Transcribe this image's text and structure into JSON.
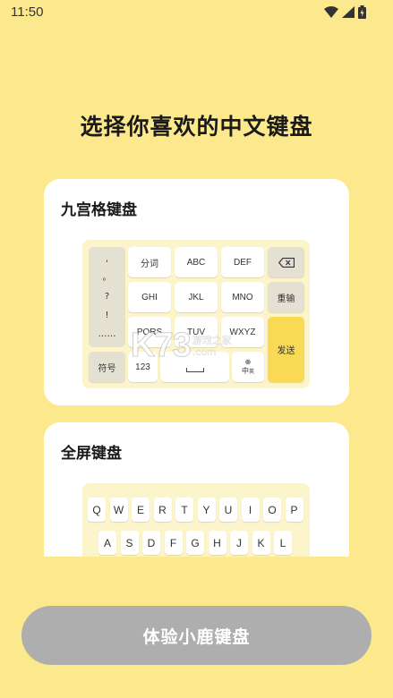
{
  "status_bar": {
    "time": "11:50"
  },
  "headline": "选择你喜欢的中文键盘",
  "nine_grid_card": {
    "title": "九宫格键盘",
    "punctuation": [
      ",",
      "。",
      "?",
      "!",
      "……"
    ],
    "keys": {
      "fenci": "分词",
      "abc": "ABC",
      "def": "DEF",
      "ghi": "GHI",
      "jkl": "JKL",
      "mno": "MNO",
      "pqrs": "PQRS",
      "tuv": "TUV",
      "wxyz": "WXYZ",
      "chongshu": "重输",
      "fasong": "发送",
      "fuhao": "符号",
      "num": "123",
      "zhong": "中",
      "zhong_sub": "英"
    }
  },
  "full_card": {
    "title": "全屏键盘",
    "row1": [
      "Q",
      "W",
      "E",
      "R",
      "T",
      "Y",
      "U",
      "I",
      "O",
      "P"
    ],
    "row2": [
      "A",
      "S",
      "D",
      "F",
      "G",
      "H",
      "J",
      "K",
      "L"
    ]
  },
  "watermark": {
    "main": "K73",
    "line1": "游戏之家",
    "line2": ".com"
  },
  "cta": {
    "label": "体验小鹿键盘"
  },
  "colors": {
    "background": "#FDE98D",
    "accent_key": "#FAD955",
    "cta_disabled": "#AEAEAE"
  }
}
